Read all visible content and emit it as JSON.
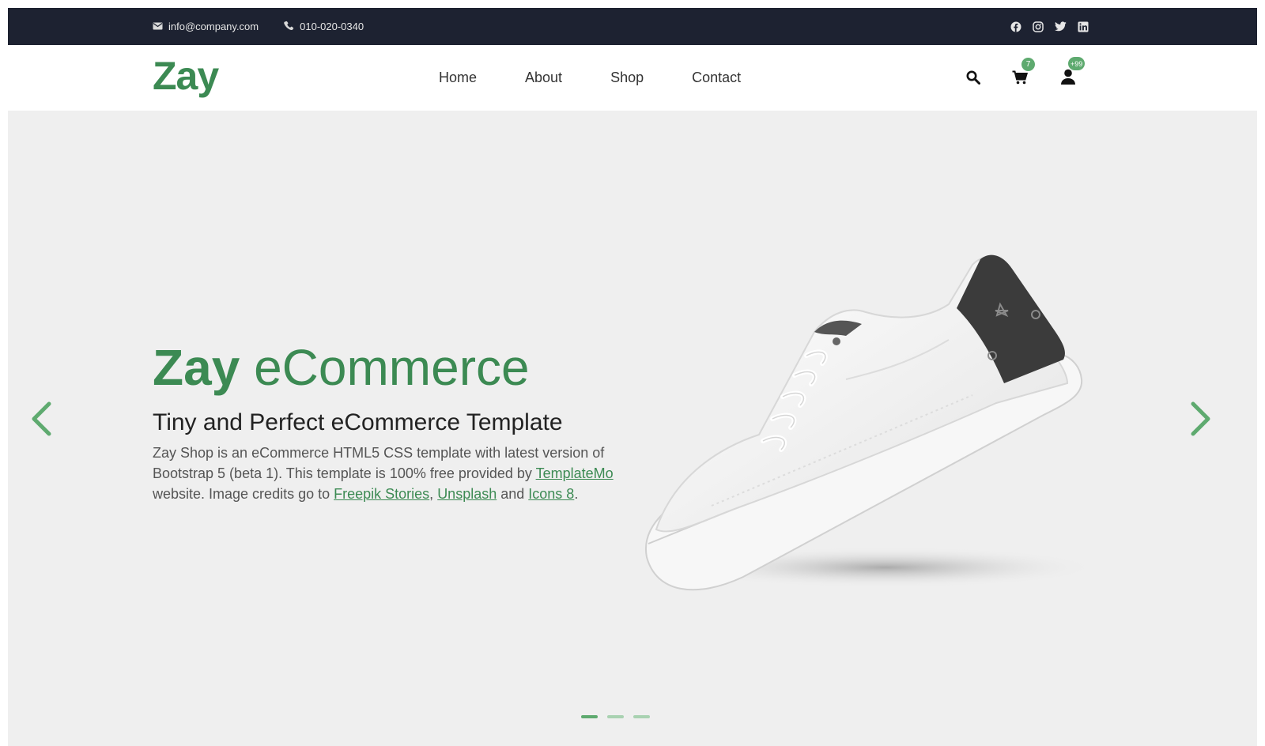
{
  "topbar": {
    "email": "info@company.com",
    "phone": "010-020-0340",
    "social_icons": [
      "facebook-icon",
      "instagram-icon",
      "twitter-icon",
      "linkedin-icon"
    ]
  },
  "navbar": {
    "logo": "Zay",
    "menu": [
      "Home",
      "About",
      "Shop",
      "Contact"
    ],
    "cart_badge": "7",
    "user_badge": "+99"
  },
  "hero": {
    "title_brand": "Zay",
    "title_rest": "eCommerce",
    "subtitle": "Tiny and Perfect eCommerce Template",
    "desc_1": "Zay Shop is an eCommerce HTML5 CSS template with latest version of Bootstrap 5 (beta 1). This template is 100% free provided by ",
    "link_templatemo": "TemplateMo",
    "desc_2": " website. Image credits go to ",
    "link_freepik": "Freepik Stories",
    "desc_3": ", ",
    "link_unsplash": "Unsplash",
    "desc_4": " and ",
    "link_icons8": "Icons 8",
    "desc_5": "."
  },
  "carousel": {
    "slide_count": 3,
    "active_index": 0
  },
  "colors": {
    "brand_green": "#3c8a53",
    "badge_green": "#5eaa6f",
    "topbar_bg": "#1d2231",
    "hero_bg": "#efefef"
  }
}
